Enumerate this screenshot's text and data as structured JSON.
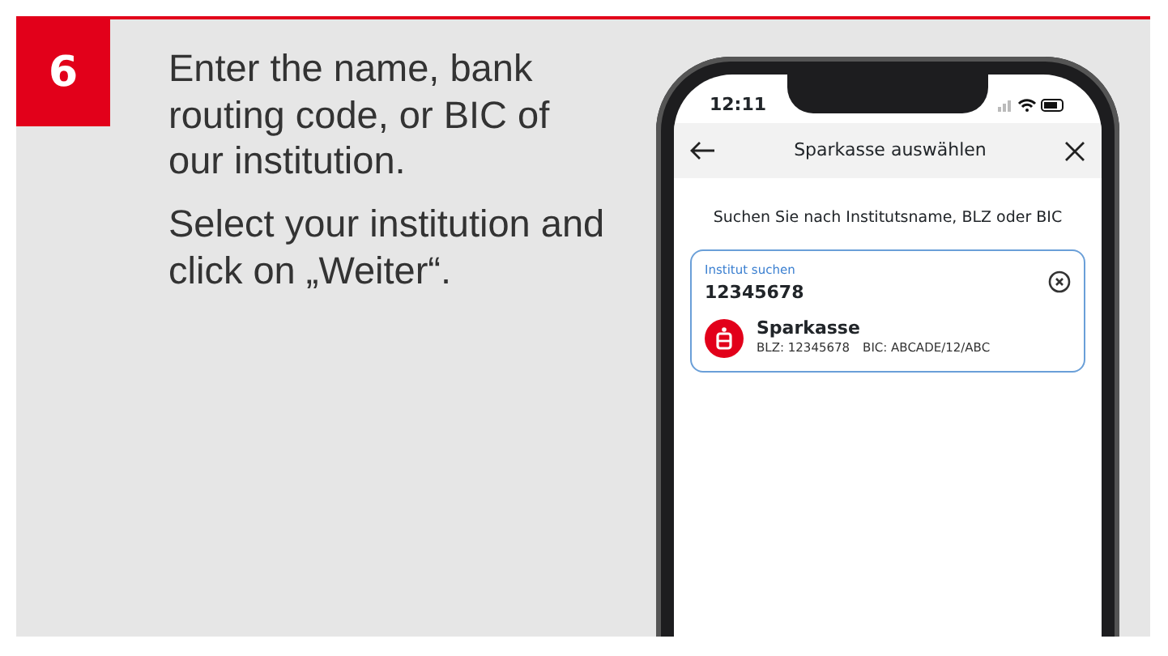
{
  "step": {
    "number": "6",
    "instructions": [
      "Enter the name, bank routing code, or BIC of our institution.",
      "Select your institution and click on „Weiter“."
    ]
  },
  "phone": {
    "status_time": "12:11",
    "header": {
      "title": "Sparkasse auswählen"
    },
    "prompt": "Suchen Sie nach Institutsname, BLZ oder BIC",
    "search": {
      "label": "Institut suchen",
      "value": "12345678"
    },
    "results": [
      {
        "name": "Sparkasse",
        "blz": "BLZ: 12345678",
        "bic": "BIC: ABCADE/12/ABC"
      }
    ]
  }
}
